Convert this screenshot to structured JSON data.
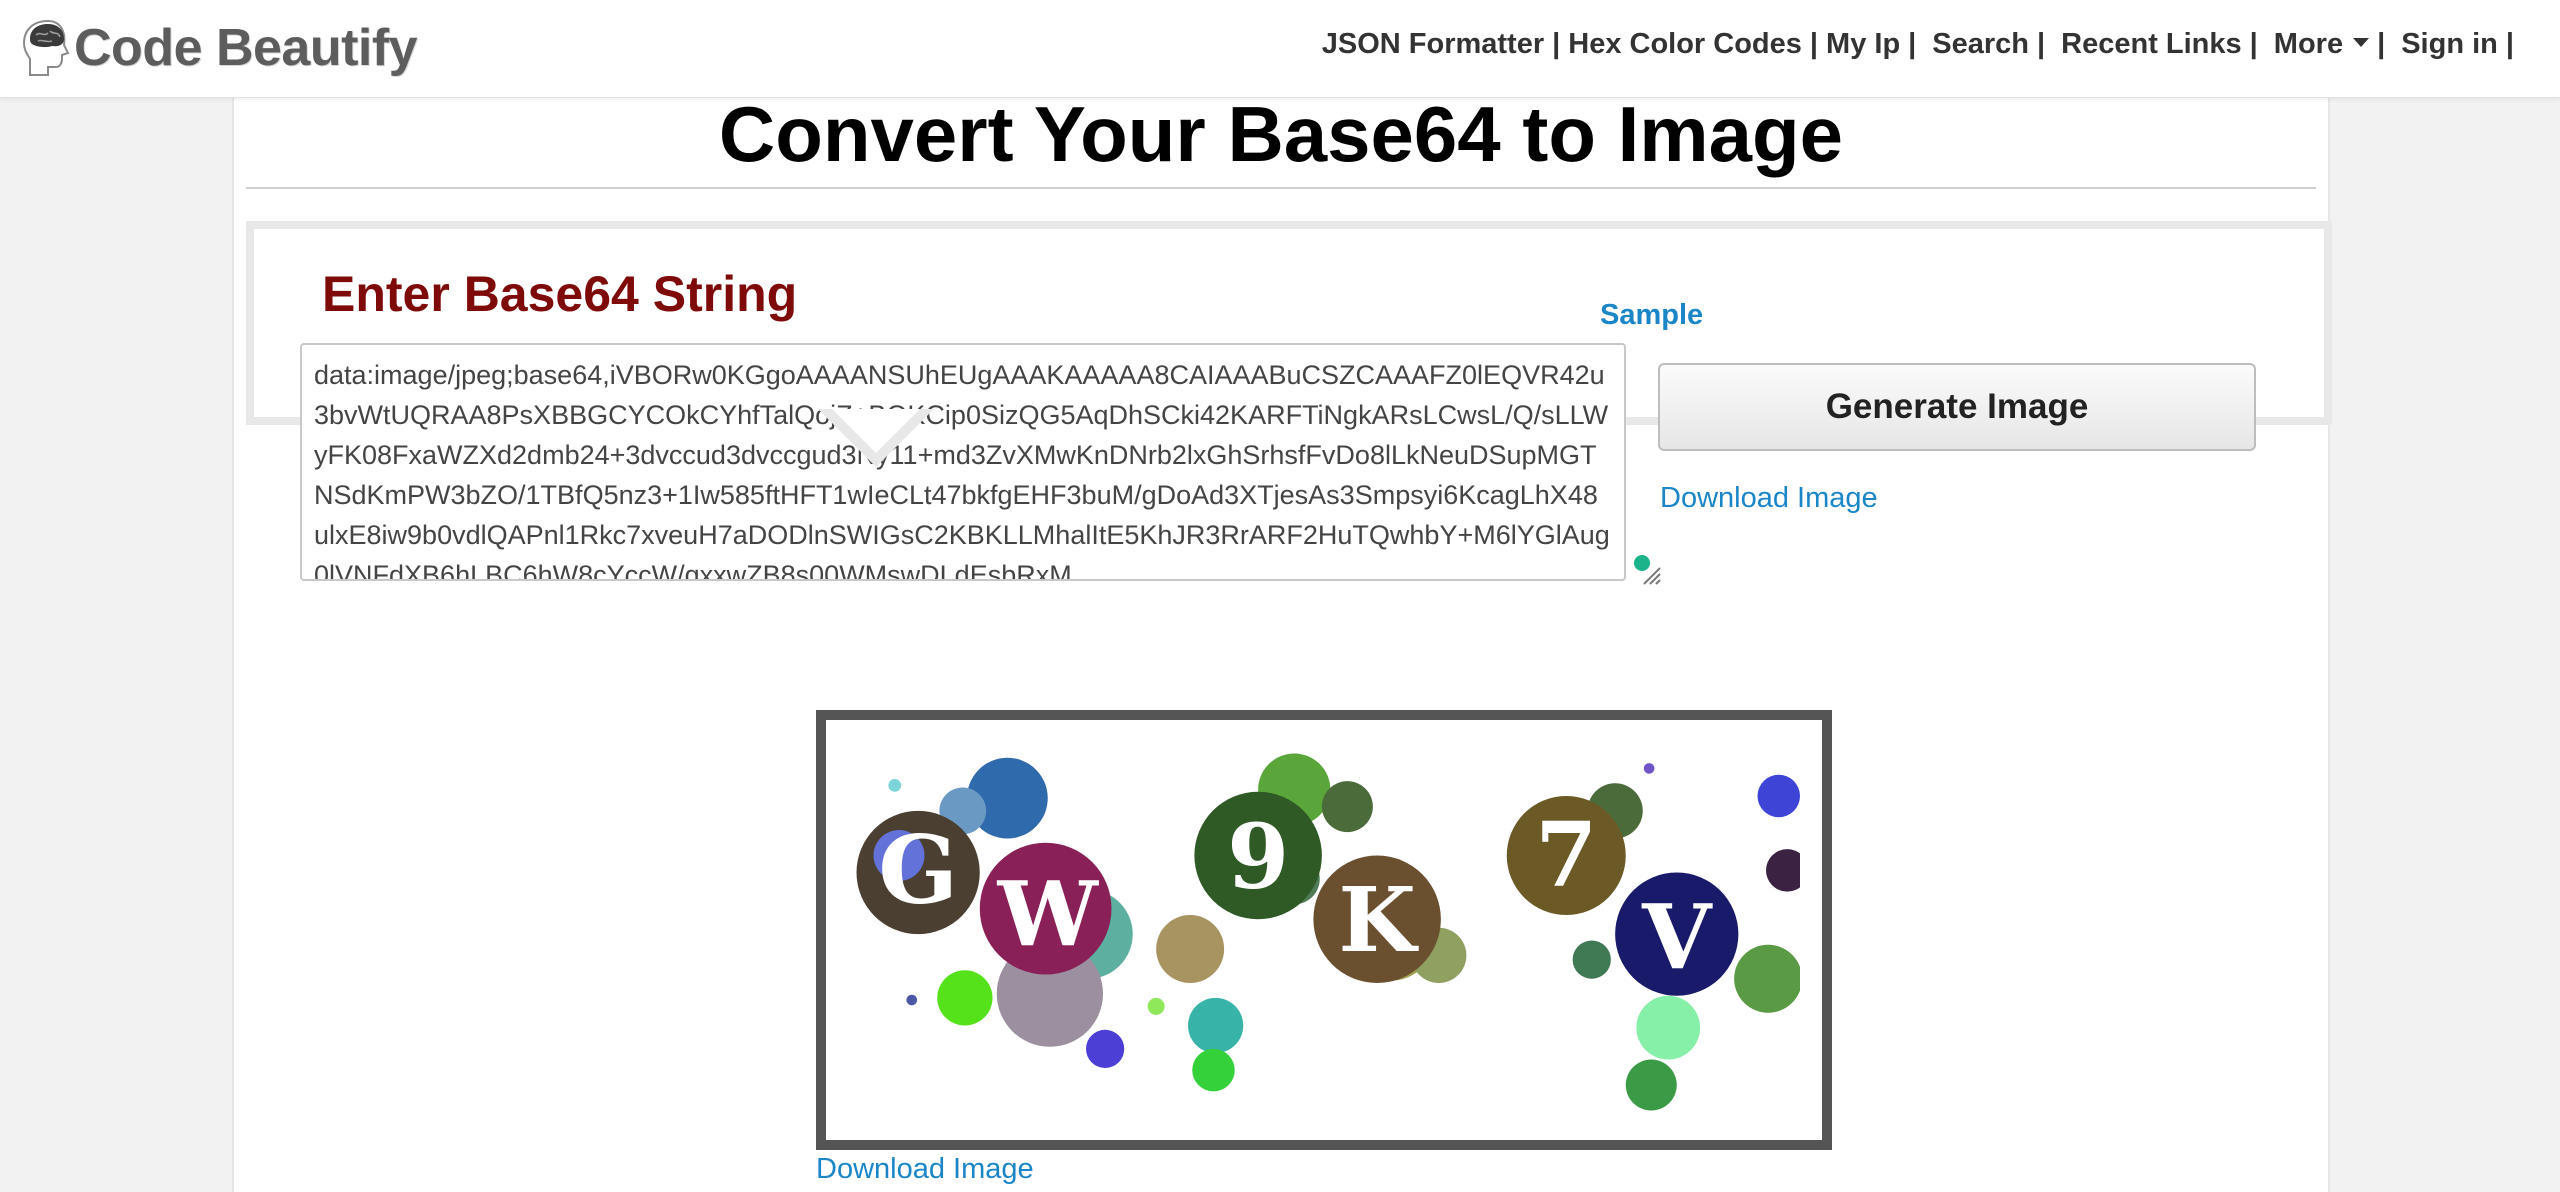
{
  "brand": {
    "name": "Code Beautify",
    "logo_icon": "brain-head-icon"
  },
  "nav": {
    "items": [
      {
        "label": "JSON Formatter"
      },
      {
        "label": "Hex Color Codes"
      },
      {
        "label": "My Ip"
      },
      {
        "label": "Search"
      },
      {
        "label": "Recent Links"
      },
      {
        "label": "More"
      },
      {
        "label": "Sign in"
      }
    ],
    "separator": "|"
  },
  "main": {
    "title": "Convert Your Base64 to Image",
    "input_heading": "Enter Base64 String",
    "sample_link": "Sample",
    "textarea_value": "data:image/jpeg;base64,iVBORw0KGgoAAAANSUhEUgAAAKAAAAA8CAIAAABuCSZCAAAFZ0lEQVR42u3bvWtUQRAA8PsXBBGCYCOkCYhfTalQojZ+BQKCip0SizQG5AqDhSCki42KARFTiNgkARsLCwsL/Q/sLLWyFK08FxaWZXd2dmb24+3dvccud3dvccgud3Ny11+md3ZvXMwKnDNrb2lxGhSrhsfFvDo8lLkNeuDSupMGTNSdKmPW3bZO/1TBfQ5nz3+1Iw585ftHFT1wIeCLt47bkfgEHF3buM/gDoAd3XTjesAs3Smpsyi6KcagLhX48ulxE8iw9b0vdlQAPnl1Rkc7xveuH7aDODlnSWIGsC2KBKLLMhalItE5KhJR3RrARF2HuTQwhbY+M6lYGlAug0lVNFdXB6hLBC6hW8cYccW/qxxwZB8s00WMswDLdEsbRxM",
    "generate_button": "Generate Image",
    "download_top": "Download Image",
    "download_bottom": "Download Image"
  },
  "preview": {
    "captcha_letters": [
      "G",
      "W",
      "9",
      "K",
      "7",
      "V"
    ]
  },
  "colors": {
    "heading_red": "#7f0a0a",
    "link_blue": "#1a86c8",
    "frame_gray": "#555555"
  }
}
